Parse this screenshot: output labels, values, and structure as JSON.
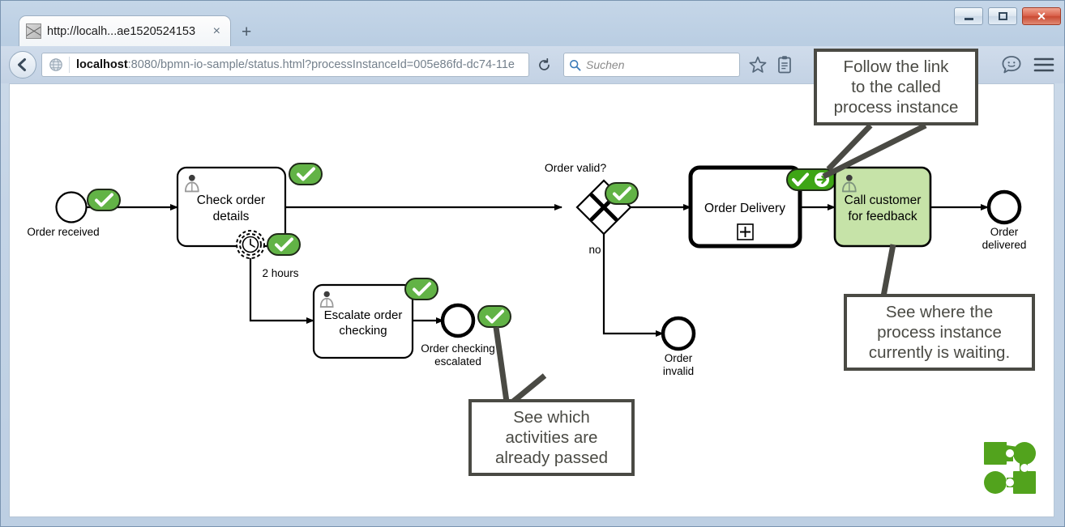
{
  "browser": {
    "tab": {
      "title": "http://localh...ae1520524153",
      "favicon": "broken-image-icon",
      "close_label": "×"
    },
    "new_tab_label": "+",
    "back_button": "back-arrow-icon",
    "url": {
      "host": "localhost",
      "rest": ":8080/bpmn-io-sample/status.html?processInstanceId=005e86fd-dc74-11e",
      "full": "localhost:8080/bpmn-io-sample/status.html?processInstanceId=005e86fd-dc74-11e"
    },
    "reload_label": "⟳",
    "search": {
      "placeholder": "Suchen"
    },
    "window_buttons": {
      "minimize": "–",
      "maximize": "□",
      "close": "✕"
    }
  },
  "diagram": {
    "type": "bpmn-process",
    "colors": {
      "stroke": "#000000",
      "badge_green": "#62b346",
      "badge_border": "#1f2a18",
      "active_fill": "#c6e3a8",
      "active_stroke": "#000000",
      "callout_border": "#4a4a44",
      "logo_green": "#52a31d"
    },
    "nodes": [
      {
        "id": "start",
        "kind": "start-event",
        "label": "Order received",
        "badge": "check"
      },
      {
        "id": "check-order",
        "kind": "user-task",
        "label": "Check order details",
        "badge": "check"
      },
      {
        "id": "timer",
        "kind": "boundary-timer-event",
        "label": "2 hours",
        "badge": "check"
      },
      {
        "id": "escalate",
        "kind": "user-task",
        "label": "Escalate order checking",
        "badge": "check"
      },
      {
        "id": "escalated-end",
        "kind": "end-event",
        "label": "Order checking escalated",
        "badge": "check"
      },
      {
        "id": "gateway",
        "kind": "exclusive-gateway",
        "label": "Order valid?",
        "badge": "check"
      },
      {
        "id": "no-flow",
        "kind": "sequence-flow-label",
        "label": "no"
      },
      {
        "id": "invalid-end",
        "kind": "end-event",
        "label": "Order invalid",
        "badge": "none"
      },
      {
        "id": "order-delivery",
        "kind": "call-activity",
        "label": "Order Delivery",
        "marker": "+",
        "badge": "check-link"
      },
      {
        "id": "call-customer",
        "kind": "user-task",
        "label": "Call customer for feedback",
        "state": "active",
        "badge": "none"
      },
      {
        "id": "delivered-end",
        "kind": "end-event",
        "label": "Order delivered",
        "badge": "none"
      }
    ],
    "labels": {
      "start": "Order received",
      "check_order": [
        "Check order",
        "details"
      ],
      "timer": "2 hours",
      "escalate": [
        "Escalate order",
        "checking"
      ],
      "escalated_end": [
        "Order checking",
        "escalated"
      ],
      "gateway": "Order valid?",
      "no": "no",
      "invalid_end": [
        "Order",
        "invalid"
      ],
      "order_delivery": "Order Delivery",
      "order_delivery_marker": "+",
      "call_customer": [
        "Call customer",
        "for feedback"
      ],
      "delivered_end": [
        "Order",
        "delivered"
      ]
    }
  },
  "callouts": [
    {
      "id": "follow-link",
      "lines": [
        "Follow the link",
        "to the called",
        "process instance"
      ]
    },
    {
      "id": "waiting",
      "lines": [
        "See where the",
        "process instance",
        "currently is waiting."
      ]
    },
    {
      "id": "passed",
      "lines": [
        "See which",
        "activities are",
        "already passed"
      ]
    }
  ]
}
